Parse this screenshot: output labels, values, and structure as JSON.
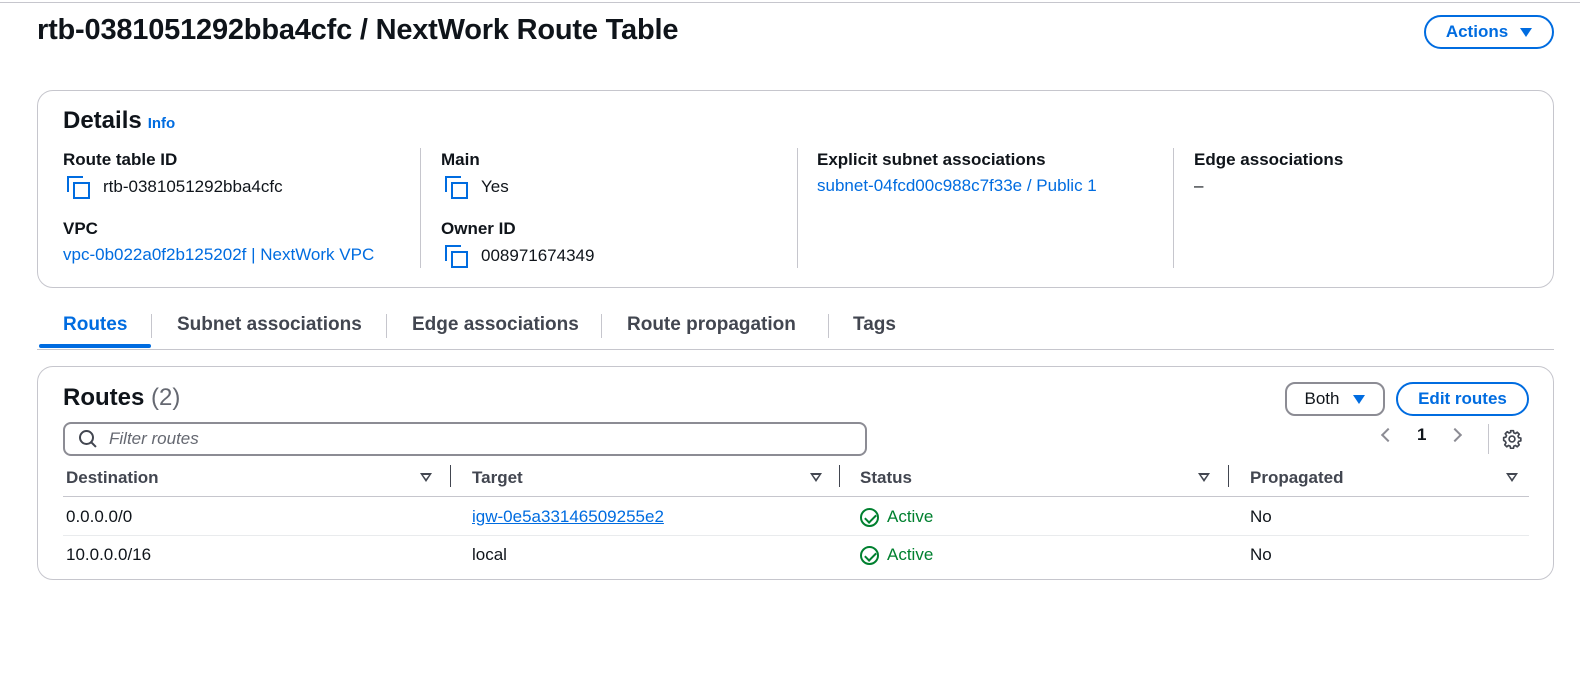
{
  "page": {
    "title": "rtb-0381051292bba4cfc / NextWork Route Table",
    "actions_label": "Actions"
  },
  "details": {
    "title": "Details",
    "info_label": "Info",
    "route_table_id": {
      "label": "Route table ID",
      "value": "rtb-0381051292bba4cfc"
    },
    "vpc": {
      "label": "VPC",
      "value": "vpc-0b022a0f2b125202f | NextWork VPC"
    },
    "main": {
      "label": "Main",
      "value": "Yes"
    },
    "owner_id": {
      "label": "Owner ID",
      "value": "008971674349"
    },
    "explicit_subnet": {
      "label": "Explicit subnet associations",
      "value": "subnet-04fcd00c988c7f33e / Public 1"
    },
    "edge": {
      "label": "Edge associations",
      "value": "–"
    }
  },
  "tabs": [
    {
      "label": "Routes",
      "active": true
    },
    {
      "label": "Subnet associations",
      "active": false
    },
    {
      "label": "Edge associations",
      "active": false
    },
    {
      "label": "Route propagation",
      "active": false
    },
    {
      "label": "Tags",
      "active": false
    }
  ],
  "routes": {
    "title": "Routes",
    "count": "(2)",
    "filter_select": "Both",
    "edit_label": "Edit routes",
    "search_placeholder": "Filter routes",
    "page": "1",
    "columns": [
      "Destination",
      "Target",
      "Status",
      "Propagated"
    ],
    "rows": [
      {
        "destination": "0.0.0.0/0",
        "target": "igw-0e5a33146509255e2",
        "target_is_link": true,
        "status": "Active",
        "propagated": "No"
      },
      {
        "destination": "10.0.0.0/16",
        "target": "local",
        "target_is_link": false,
        "status": "Active",
        "propagated": "No"
      }
    ]
  },
  "colors": {
    "accent": "#006ce0",
    "success": "#00802f",
    "text": "#0f141a",
    "border": "#c6c6cd"
  }
}
